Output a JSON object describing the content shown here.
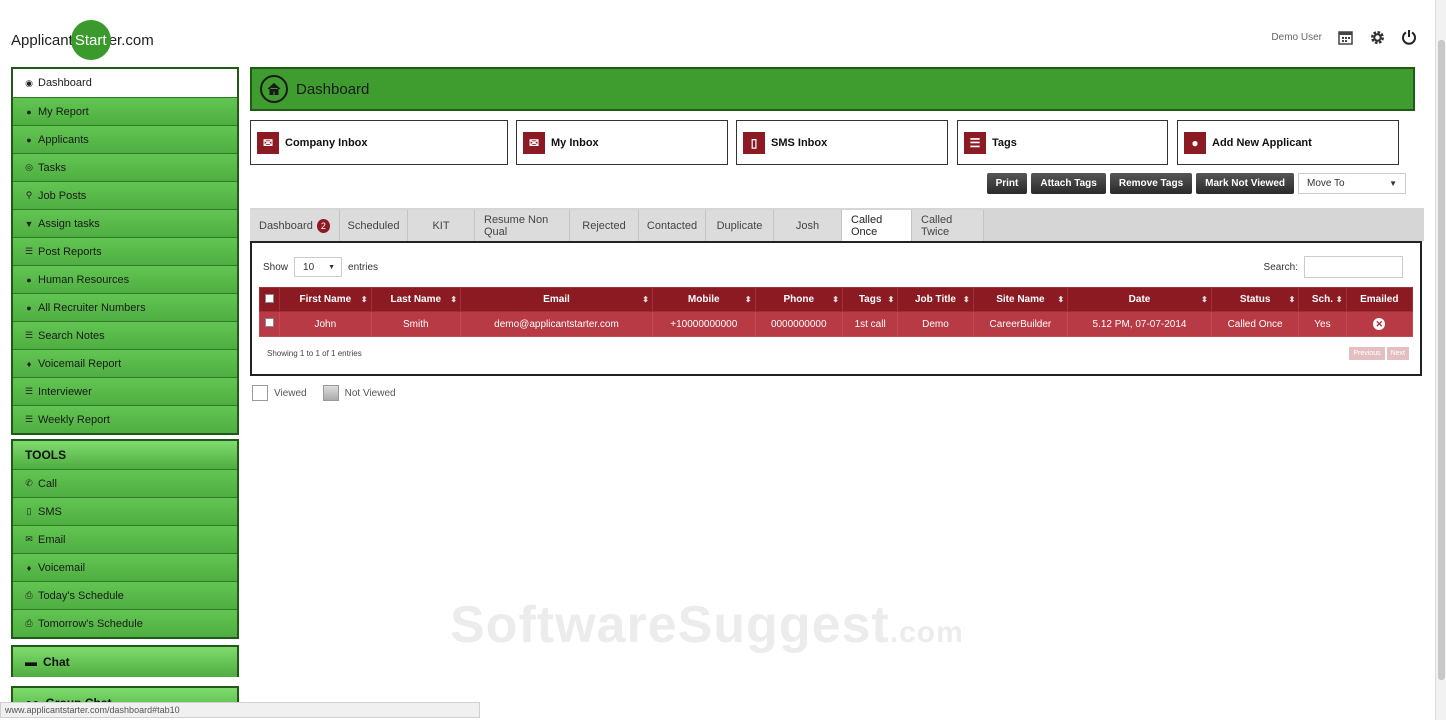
{
  "header": {
    "logo_pre": "Applicant",
    "logo_mid": "Start",
    "logo_post": "er.com",
    "user": "Demo User"
  },
  "sidebar": {
    "items": [
      {
        "label": "Dashboard",
        "icon": "dashboard-icon",
        "glyph": "◉"
      },
      {
        "label": "My Report",
        "icon": "user-icon",
        "glyph": "●"
      },
      {
        "label": "Applicants",
        "icon": "user-icon",
        "glyph": "●"
      },
      {
        "label": "Tasks",
        "icon": "tasks-icon",
        "glyph": "◎"
      },
      {
        "label": "Job Posts",
        "icon": "search-icon",
        "glyph": "⚲"
      },
      {
        "label": "Assign tasks",
        "icon": "filter-icon",
        "glyph": "▼"
      },
      {
        "label": "Post Reports",
        "icon": "list-icon",
        "glyph": "☰"
      },
      {
        "label": "Human Resources",
        "icon": "user-icon",
        "glyph": "●"
      },
      {
        "label": "All Recruiter Numbers",
        "icon": "user-icon",
        "glyph": "●"
      },
      {
        "label": "Search Notes",
        "icon": "list-icon",
        "glyph": "☰"
      },
      {
        "label": "Voicemail Report",
        "icon": "microphone-icon",
        "glyph": "♦"
      },
      {
        "label": "Interviewer",
        "icon": "list-icon",
        "glyph": "☰"
      },
      {
        "label": "Weekly Report",
        "icon": "list-icon",
        "glyph": "☰"
      }
    ]
  },
  "tools": {
    "heading": "TOOLS",
    "items": [
      {
        "label": "Call",
        "icon": "phone-icon",
        "glyph": "✆"
      },
      {
        "label": "SMS",
        "icon": "mobile-icon",
        "glyph": "▯"
      },
      {
        "label": "Email",
        "icon": "mail-icon",
        "glyph": "✉"
      },
      {
        "label": "Voicemail",
        "icon": "microphone-icon",
        "glyph": "♦"
      },
      {
        "label": "Today's Schedule",
        "icon": "print-icon",
        "glyph": "⎙"
      },
      {
        "label": "Tomorrow's Schedule",
        "icon": "print-icon",
        "glyph": "⎙"
      }
    ]
  },
  "chat": {
    "label": "Chat",
    "group_label": "Group Chat"
  },
  "main": {
    "title": "Dashboard",
    "quick_boxes": [
      {
        "label": "Company Inbox",
        "icon": "mail-icon",
        "glyph": "✉"
      },
      {
        "label": "My Inbox",
        "icon": "mail-icon",
        "glyph": "✉"
      },
      {
        "label": "SMS Inbox",
        "icon": "mobile-icon",
        "glyph": "▯"
      },
      {
        "label": "Tags",
        "icon": "list-icon",
        "glyph": "☰"
      },
      {
        "label": "Add New Applicant",
        "icon": "user-icon",
        "glyph": "●"
      }
    ],
    "actions": {
      "print": "Print",
      "attach_tags": "Attach Tags",
      "remove_tags": "Remove Tags",
      "mark_not_viewed": "Mark Not Viewed",
      "move_to": "Move To"
    },
    "tabs": [
      {
        "label": "Dashboard",
        "badge": "2"
      },
      {
        "label": "Scheduled"
      },
      {
        "label": "KIT"
      },
      {
        "label": "Resume Non Qual"
      },
      {
        "label": "Rejected"
      },
      {
        "label": "Contacted"
      },
      {
        "label": "Duplicate"
      },
      {
        "label": "Josh"
      },
      {
        "label": "Called Once",
        "active": true
      },
      {
        "label": "Called Twice"
      }
    ],
    "table": {
      "show_label": "Show",
      "entries_value": "10",
      "entries_label": "entries",
      "search_label": "Search:",
      "columns": [
        "First Name",
        "Last Name",
        "Email",
        "Mobile",
        "Phone",
        "Tags",
        "Job Title",
        "Site Name",
        "Date",
        "Status",
        "Sch.",
        "Emailed"
      ],
      "rows": [
        [
          "John",
          "Smith",
          "demo@applicantstarter.com",
          "+10000000000",
          "0000000000",
          "1st call",
          "Demo",
          "CareerBuilder",
          "5.12 PM, 07-07-2014",
          "Called Once",
          "Yes",
          ""
        ]
      ],
      "showing": "Showing 1 to 1 of 1 entries",
      "prev": "Previous",
      "next": "Next"
    },
    "legend": {
      "viewed": "Viewed",
      "not_viewed": "Not Viewed"
    }
  },
  "watermark": {
    "main": "SoftwareSuggest",
    "suffix": ".com"
  },
  "status_url": "www.applicantstarter.com/dashboard#tab10"
}
